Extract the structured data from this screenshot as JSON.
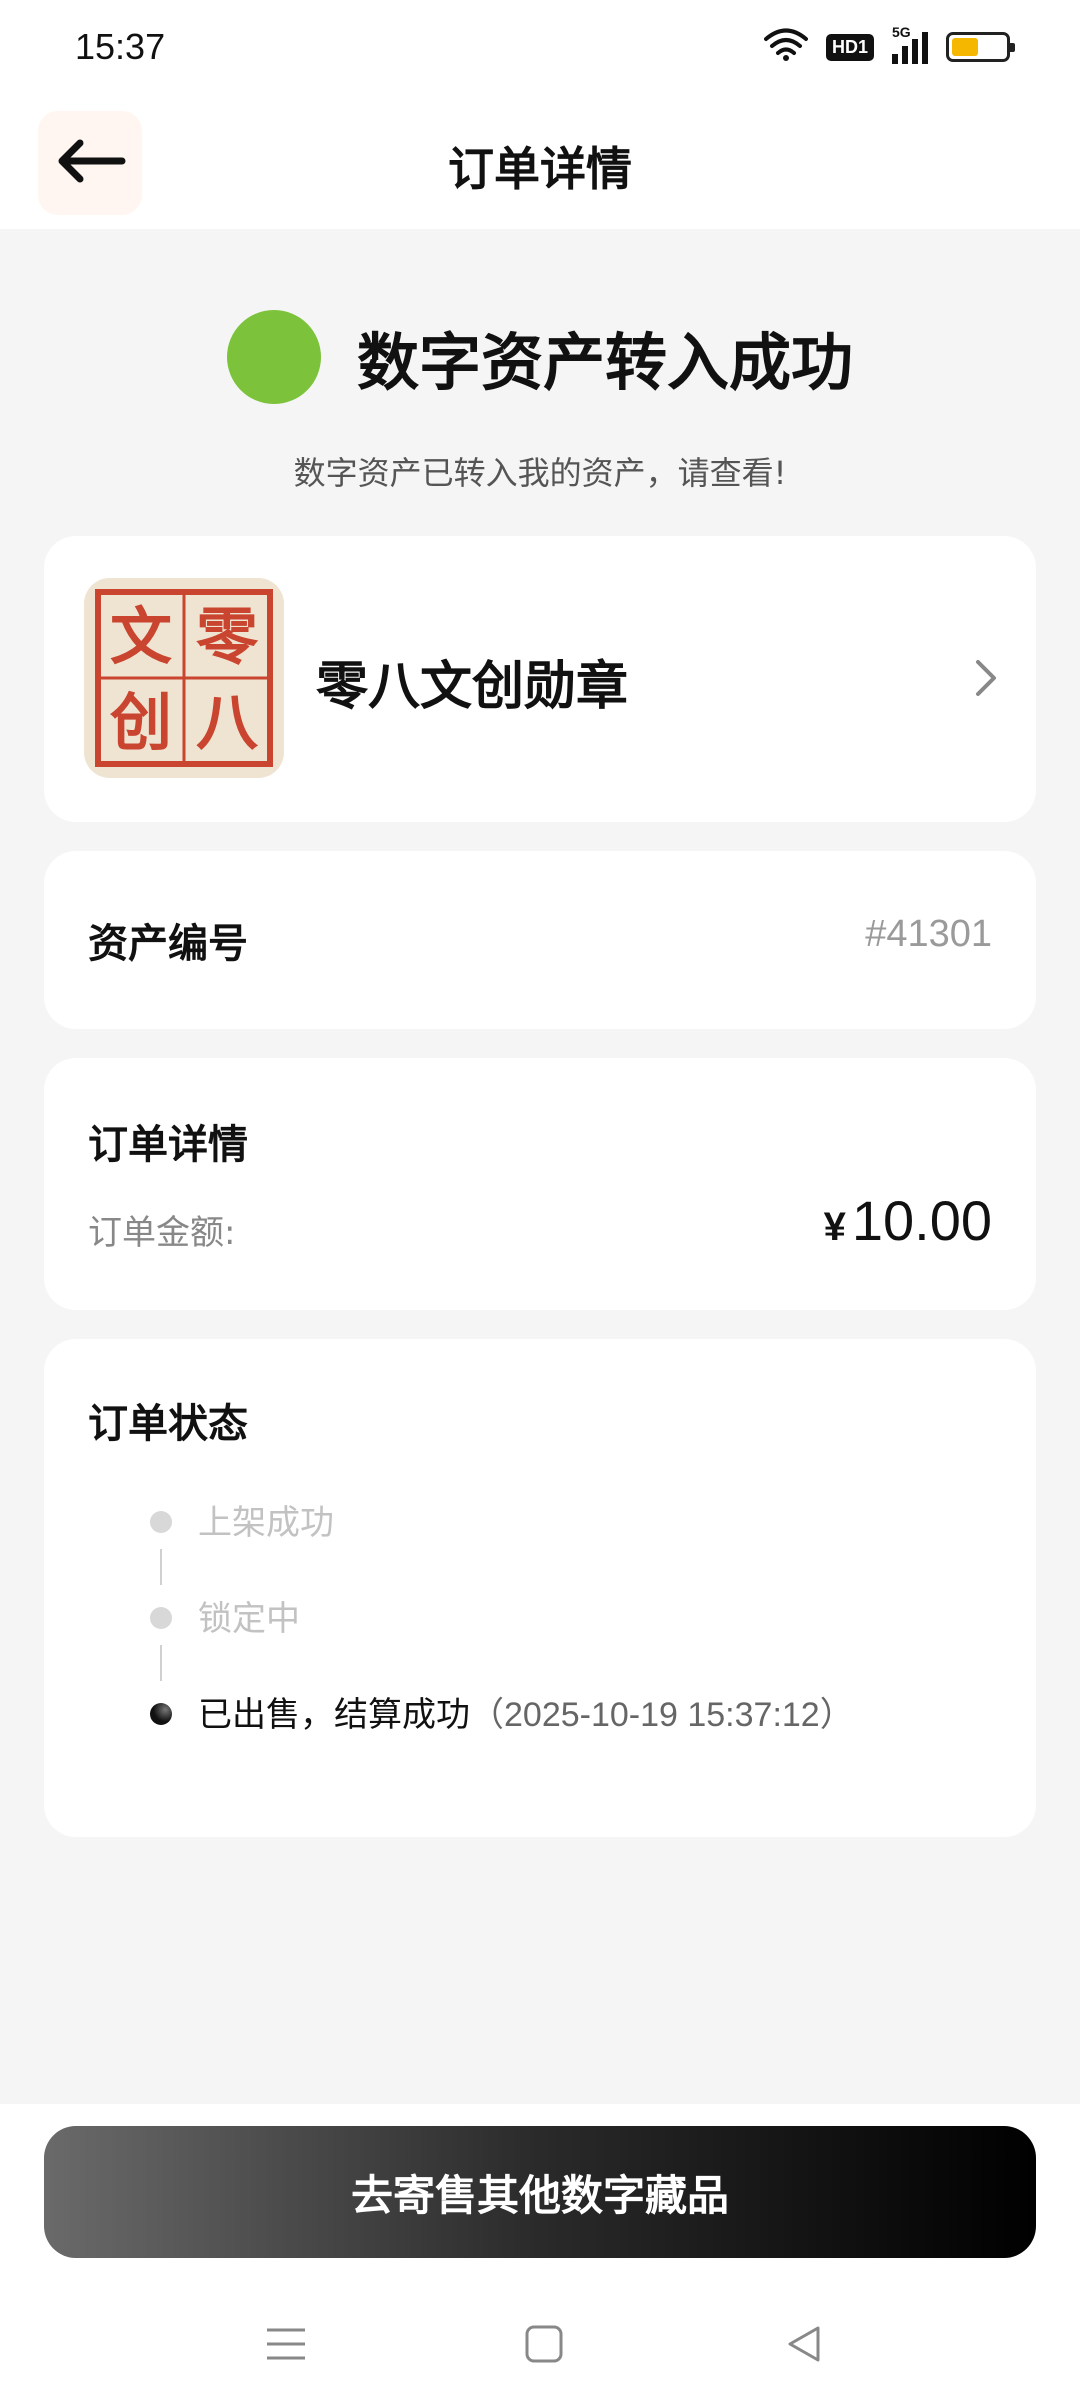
{
  "status_bar": {
    "time": "15:37",
    "network_badge": "HD1",
    "signal_label": "5G",
    "battery_level": 0.45,
    "battery_color": "#f5b700"
  },
  "nav": {
    "back_icon": "arrow-left-icon",
    "title": "订单详情"
  },
  "success": {
    "title": "数字资产转入成功",
    "subtitle": "数字资产已转入我的资产，请查看!",
    "dot_color": "#7cc23a"
  },
  "product": {
    "name": "零八文创勋章",
    "seal_chars": [
      "零",
      "八",
      "文",
      "创"
    ]
  },
  "asset": {
    "label": "资产编号",
    "value": "#41301"
  },
  "order_detail": {
    "title": "订单详情",
    "amount_label": "订单金额:",
    "currency": "¥",
    "amount": "10.00"
  },
  "order_status": {
    "title": "订单状态",
    "steps": [
      {
        "label": "上架成功",
        "time": "",
        "active": false
      },
      {
        "label": "锁定中",
        "time": "",
        "active": false
      },
      {
        "label": "已出售，结算成功",
        "time": "（2025-10-19 15:37:12）",
        "active": true
      }
    ]
  },
  "cta": {
    "label": "去寄售其他数字藏品"
  },
  "system_nav": {
    "menu_icon": "menu-icon",
    "home_icon": "home-square-icon",
    "back_icon": "back-triangle-icon"
  }
}
